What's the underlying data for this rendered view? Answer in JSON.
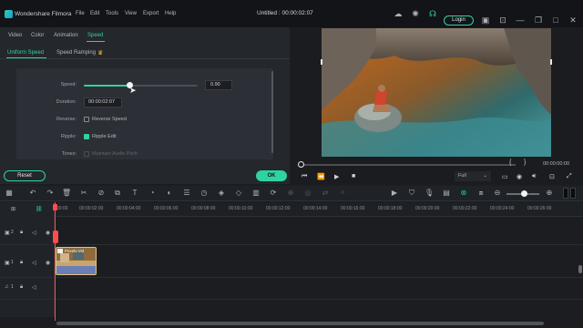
{
  "app": {
    "name": "Wondershare Filmora",
    "menu": [
      "File",
      "Edit",
      "Tools",
      "View",
      "Export",
      "Help"
    ],
    "document_title": "Untitled : 00:00:02:07",
    "login_label": "Login"
  },
  "left_panel": {
    "tabs": [
      "Video",
      "Color",
      "Animation",
      "Speed"
    ],
    "active_tab": "Speed",
    "subtabs": [
      "Uniform Speed",
      "Speed Ramping"
    ],
    "active_subtab": "Uniform Speed",
    "speed": {
      "label": "Speed:",
      "value": "0.90",
      "slider_fraction": 0.4
    },
    "duration": {
      "label": "Duration:",
      "value": "00:00:02:07"
    },
    "reverse": {
      "label": "Reverse:",
      "option": "Reverse Speed",
      "checked": false
    },
    "ripple": {
      "label": "Ripple:",
      "option": "Ripple Edit",
      "checked": true
    },
    "tones": {
      "label": "Tones:",
      "option": "Maintain Audio Pitch",
      "checked": false
    },
    "reset_label": "Reset",
    "ok_label": "OK"
  },
  "preview": {
    "time": "00:00:00:00",
    "quality": "Full",
    "bracket_left": "{",
    "bracket_right": "}"
  },
  "timeline": {
    "ruler_ticks": [
      "00:00",
      "00:00:02:00",
      "00:00:04:00",
      "00:00:06:00",
      "00:00:08:00",
      "00:00:10:00",
      "00:00:12:00",
      "00:00:14:00",
      "00:00:16:00",
      "00:00:18:00",
      "00:00:20:00",
      "00:00:22:00",
      "00:00:24:00",
      "00:00:26:00"
    ],
    "tracks": [
      {
        "id": "2",
        "kind": "video"
      },
      {
        "id": "1",
        "kind": "video"
      },
      {
        "id": "1",
        "kind": "audio"
      }
    ],
    "clip": {
      "title": "Pexels Vid"
    }
  },
  "colors": {
    "accent": "#2fd3a2",
    "playhead": "#ff4d4f",
    "clip_border": "#e5c37a"
  }
}
